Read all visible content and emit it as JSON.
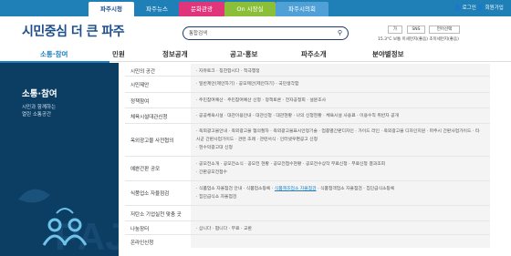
{
  "top_tabs": [
    "파주시청",
    "파주뉴스",
    "문화관광",
    "On 시장실",
    "파주시의회"
  ],
  "top_right": {
    "login": "로그인",
    "join": "회원가입"
  },
  "logo": {
    "main": "시민중심 더 큰 파주",
    "small": "더"
  },
  "search": {
    "placeholder": "통합검색"
  },
  "tools": [
    "가",
    "SNS",
    "언어선택"
  ],
  "weather": "15.3°C 보통 미세먼지(좋음) 초미세먼지(좋음)",
  "nav": [
    "소통·참여",
    "민원",
    "정보공개",
    "공고·홍보",
    "파주소개",
    "분야별정보"
  ],
  "sidebar": {
    "title": "소통·참여",
    "sub1": "시민과 함께하는",
    "sub2": "열린 소통공간"
  },
  "rows": [
    {
      "cat": "시민의 공간",
      "cells": [
        "· 자유토크  · 칭찬합시다  · 적극행정"
      ]
    },
    {
      "cat": "시민제안",
      "cells": [
        "· 일반제안(제안하기)  · 공모제안(제안하기)  · 국민생각함"
      ]
    },
    {
      "cat": "정책참여",
      "cells": [
        "· 주민참여예산  · 주민참여예산 신청  · 정책토론  · 전자공청회  · 설문조사"
      ]
    },
    {
      "cat": "체육시설대관신청",
      "cells": [
        "· 공공체육시설  · 대관이용안내  · 대관신청  · 대관현황  · 나의 신청현황  · 체육시설 사용료  · 이용수칙 위반자 공개"
      ]
    },
    {
      "cat": "옥외광고물 사전협의",
      "cells": [
        "· 옥외광고물안내  · 옥외광고물 협의절차  · 옥외광고물표시안정기술  · 업종별간판디자인  · 가이드 라인  · 옥외광고물 디자인지원  · 파주시 간판사업가이드  · 타 시군 간판사업가이드  · 관련 조례  · 관련서식  · 인터넷우편공고 신청",
        "· 현수막광고대 신청"
      ]
    },
    {
      "cat": "예쁜간판 공모",
      "cells": [
        "· 공모전소개  · 공모전소식  · 공모전 현황  · 공모전접수현황  · 공모전수상작 무료신청  · 무료신청 결과조회",
        "· 간판공모전접수"
      ]
    },
    {
      "cat": "식품업소 자율점검",
      "cells": [
        "· 식품업소 자율점검 안내  · 식품업소등록  · 식품제조업소 자율점검  · 식품접객업소 자율점검  · 집단급식소등록",
        "· 집단급식소 자율점검"
      ]
    },
    {
      "cat": "저탄소 기업실천 맞춤 곳",
      "cells": [
        ""
      ]
    },
    {
      "cat": "나눔장터",
      "cells": [
        "· 삽니다  · 팝니다  · 무료  · 교환"
      ]
    },
    {
      "cat": "온라인신청",
      "cells": [
        ""
      ]
    }
  ],
  "highlight_cell": "· 식품제조업소 자율점검"
}
